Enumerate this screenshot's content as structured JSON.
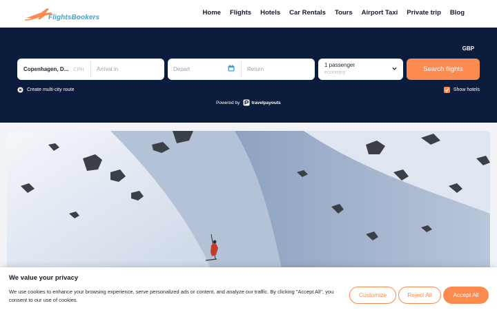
{
  "brand": {
    "name": "FlightsBookers",
    "accent": "#fd8a4f",
    "dark": "#0c1c3c",
    "logo_text_color": "#3aa5d4"
  },
  "nav": [
    "Home",
    "Flights",
    "Hotels",
    "Car Rentals",
    "Tours",
    "Airport Taxi",
    "Private trip",
    "Blog"
  ],
  "search": {
    "currency": "GBP",
    "from_city": "Copenhagen, D...",
    "from_code": "CPH",
    "to_placeholder": "Arrival in",
    "depart_placeholder": "Depart",
    "return_placeholder": "Return",
    "passengers": "1 passenger",
    "cabin_class": "economy",
    "submit_label": "Search flights",
    "multi_city_label": "Create multi-city route",
    "show_hotels_label": "Show hotels",
    "show_hotels_checked": true,
    "powered_by": "Powered by",
    "partner": "travelpayouts"
  },
  "cookie": {
    "title": "We value your privacy",
    "text": "We use cookies to enhance your browsing experience, serve personalized ads or content, and analyze our traffic. By clicking \"Accept All\", you consent to our use of cookies.",
    "customize_label": "Customize",
    "reject_label": "Reject All",
    "accept_label": "Accept All"
  }
}
